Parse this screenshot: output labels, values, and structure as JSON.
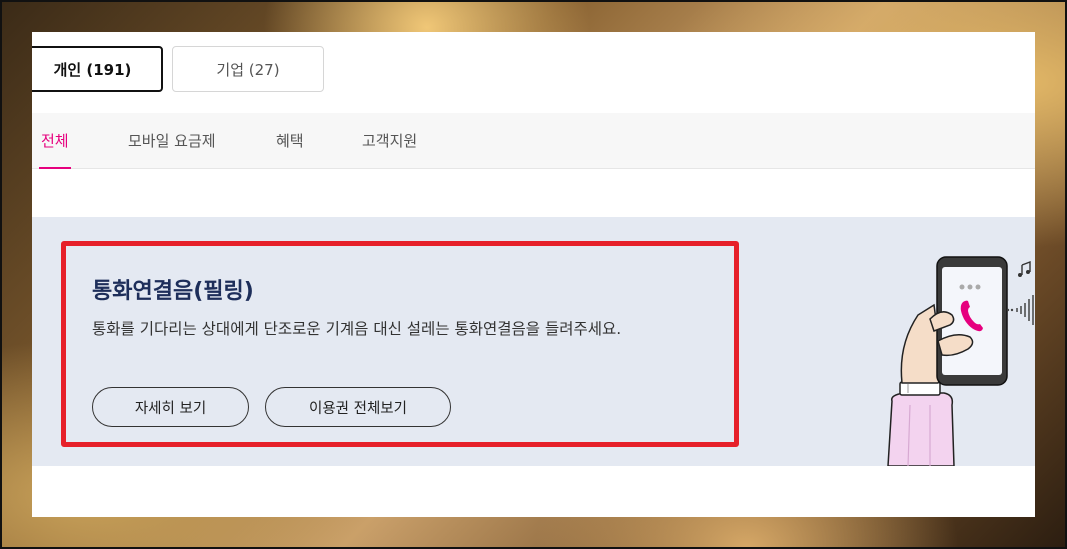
{
  "segments": [
    {
      "label": "개인 (191)",
      "active": true
    },
    {
      "label": "기업 (27)",
      "active": false
    }
  ],
  "nav": {
    "tabs": [
      {
        "label": "전체",
        "active": true
      },
      {
        "label": "모바일 요금제",
        "active": false
      },
      {
        "label": "혜택",
        "active": false
      },
      {
        "label": "고객지원",
        "active": false
      }
    ]
  },
  "banner": {
    "title": "통화연결음(필링)",
    "description": "통화를 기다리는 상대에게 단조로운 기계음 대신 설레는 통화연결음을 들려주세요.",
    "buttons": {
      "detail": "자세히 보기",
      "all_passes": "이용권 전체보기"
    }
  },
  "colors": {
    "accent": "#e6007e",
    "highlight_border": "#e6202a",
    "banner_bg": "#e4e9f2",
    "title": "#1d2e5a"
  }
}
